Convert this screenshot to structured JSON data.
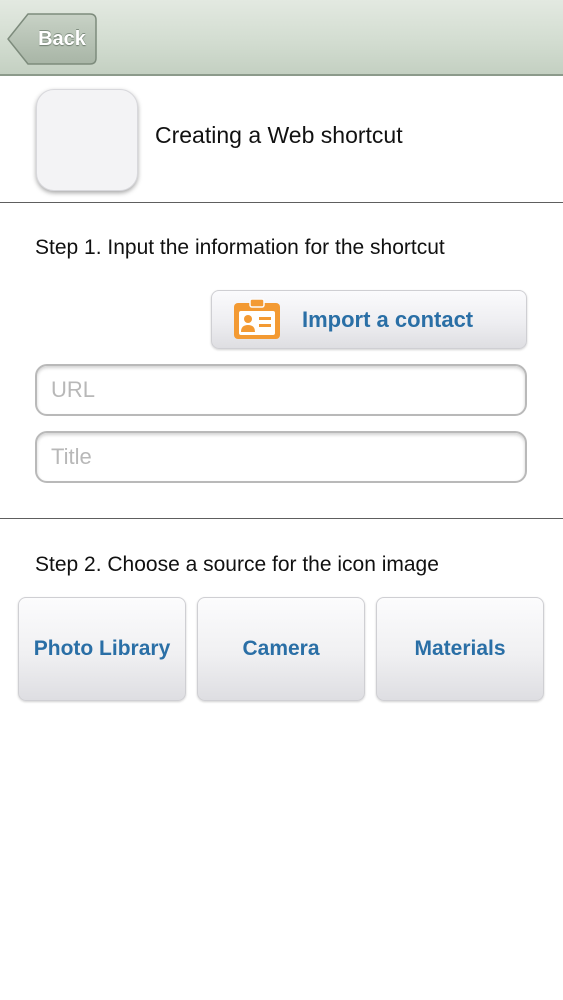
{
  "navbar": {
    "back_label": "Back"
  },
  "header": {
    "title": "Creating a Web shortcut"
  },
  "step1": {
    "label": "Step 1. Input the information for the shortcut",
    "import_label": "Import a contact",
    "url_placeholder": "URL",
    "url_value": "",
    "title_placeholder": "Title",
    "title_value": ""
  },
  "step2": {
    "label": "Step 2. Choose a source for the icon image",
    "buttons": [
      {
        "label": "Photo Library"
      },
      {
        "label": "Camera"
      },
      {
        "label": "Materials"
      }
    ]
  },
  "colors": {
    "accent": "#2a6fa6",
    "contact_icon": "#f39a33",
    "navbar": "#d3ddd1"
  },
  "icons": {
    "back": "back-arrow-icon",
    "contact": "contact-card-icon"
  }
}
